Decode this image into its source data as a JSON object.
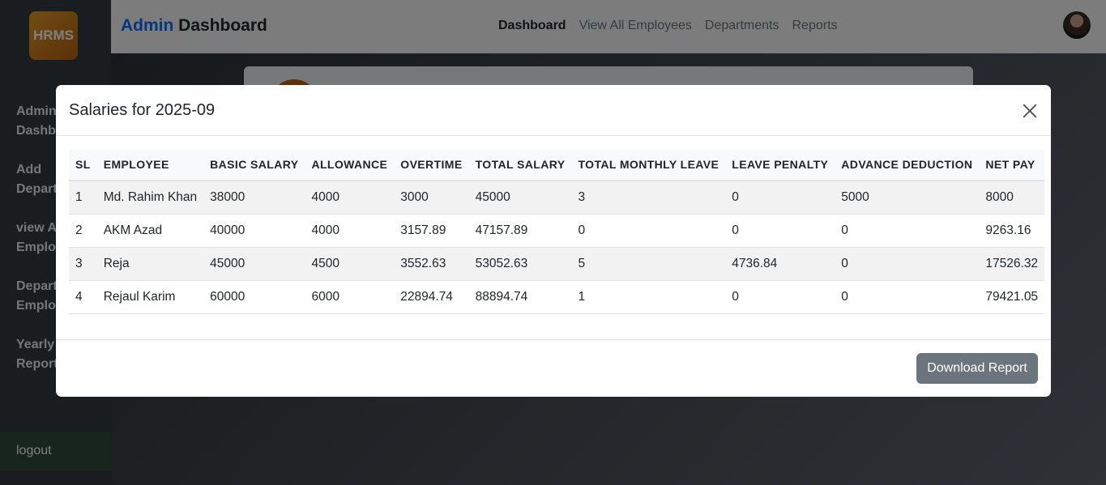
{
  "sidebar": {
    "logo": "HRMS",
    "items": [
      {
        "label": "Admin\nDashboard"
      },
      {
        "label": "Add\nDepartment"
      },
      {
        "label": "view All\nEmployees"
      },
      {
        "label": "Department\nEmployees"
      },
      {
        "label": "Yearly Salary\nReports"
      }
    ],
    "logout": "logout"
  },
  "header": {
    "brand_part1": "Admin",
    "brand_part2": "Dashboard",
    "nav": [
      {
        "label": "Dashboard",
        "active": true
      },
      {
        "label": "View All Employees",
        "active": false
      },
      {
        "label": "Departments",
        "active": false
      },
      {
        "label": "Reports",
        "active": false
      }
    ]
  },
  "modal": {
    "title": "Salaries for 2025-09",
    "columns": [
      "SL",
      "EMPLOYEE",
      "BASIC SALARY",
      "ALLOWANCE",
      "OVERTIME",
      "TOTAL SALARY",
      "TOTAL MONTHLY LEAVE",
      "LEAVE PENALTY",
      "ADVANCE DEDUCTION",
      "NET PAY"
    ],
    "rows": [
      [
        "1",
        "Md. Rahim Khan",
        "38000",
        "4000",
        "3000",
        "45000",
        "3",
        "0",
        "5000",
        "8000"
      ],
      [
        "2",
        "AKM Azad",
        "40000",
        "4000",
        "3157.89",
        "47157.89",
        "0",
        "0",
        "0",
        "9263.16"
      ],
      [
        "3",
        "Reja",
        "45000",
        "4500",
        "3552.63",
        "53052.63",
        "5",
        "4736.84",
        "0",
        "17526.32"
      ],
      [
        "4",
        "Rejaul Karim",
        "60000",
        "6000",
        "22894.74",
        "88894.74",
        "1",
        "0",
        "0",
        "79421.05"
      ]
    ],
    "download_label": "Download Report"
  },
  "colors": {
    "accent": "#0d6efd",
    "sidebar": "#343a40",
    "button": "#6c757d"
  }
}
